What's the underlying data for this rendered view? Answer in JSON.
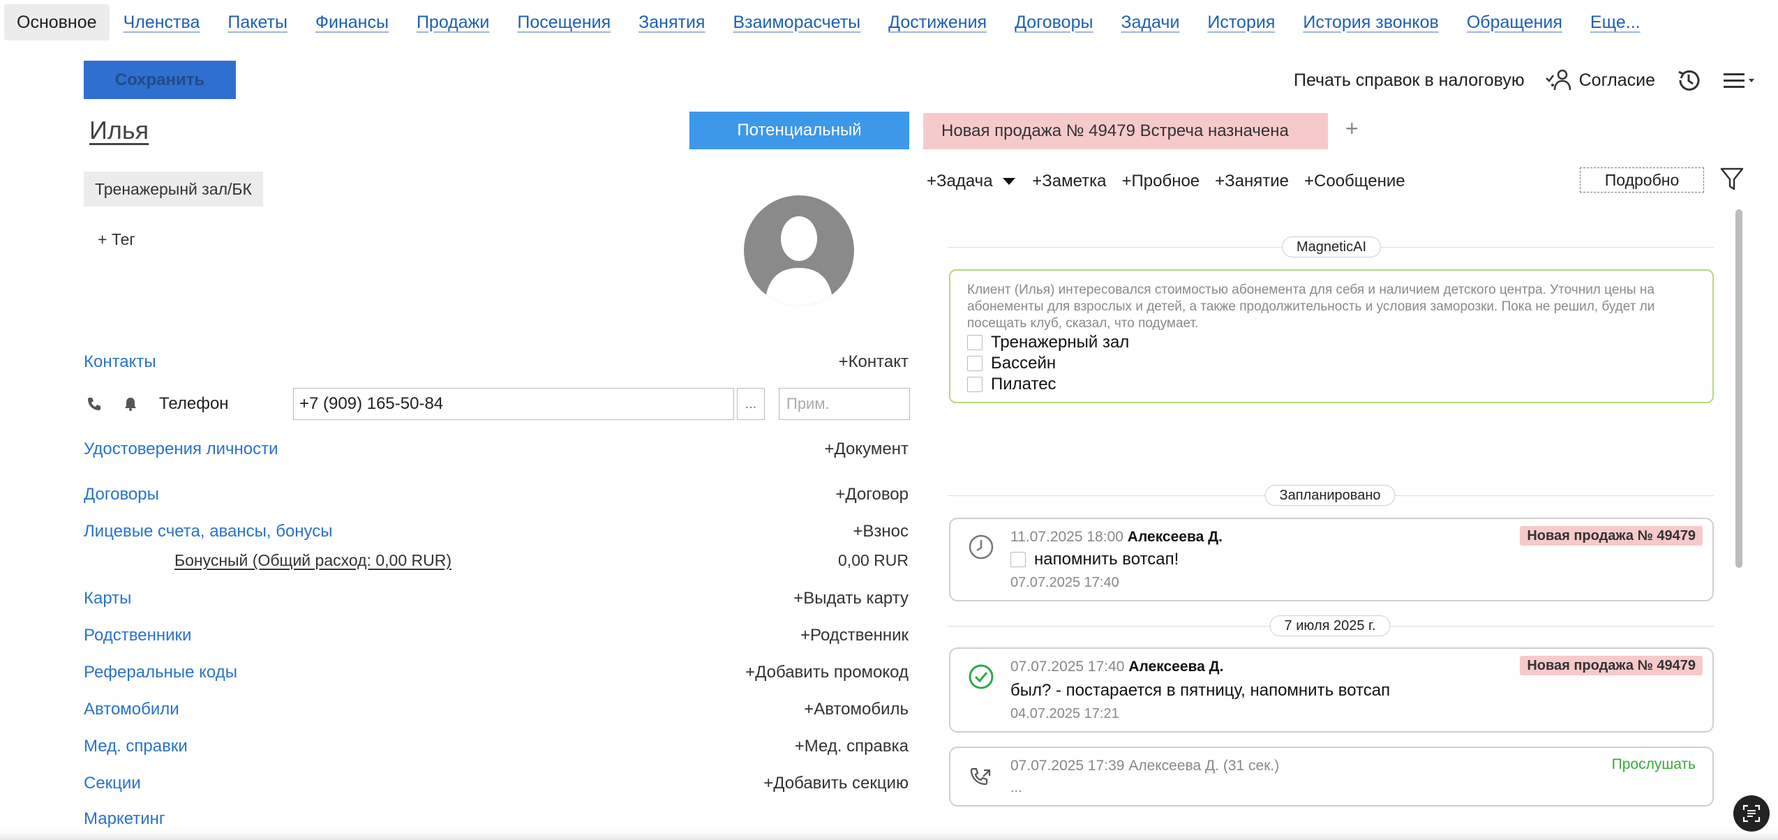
{
  "tabs": [
    "Основное",
    "Членства",
    "Пакеты",
    "Финансы",
    "Продажи",
    "Посещения",
    "Занятия",
    "Взаиморасчеты",
    "Достижения",
    "Договоры",
    "Задачи",
    "История",
    "История звонков",
    "Обращения",
    "Еще..."
  ],
  "toolbar": {
    "save_label": "Сохранить",
    "tax_print_label": "Печать справок в налоговую",
    "consent_label": "Согласие"
  },
  "client": {
    "name": "Илья",
    "status_label": "Потенциальный",
    "sale_tag": "Новая продажа № 49479  Встреча назначена",
    "add_tab": "+",
    "club_tag": "Тренажерынй зал/БК",
    "add_tag": "+ Тег"
  },
  "sections": {
    "contacts": {
      "label": "Контакты",
      "action": "+Контакт"
    },
    "phone": {
      "label": "Телефон",
      "value": "+7 (909) 165-50-84",
      "dots": "...",
      "note_placeholder": "Прим."
    },
    "ids": {
      "label": "Удостоверения личности",
      "action": "+Документ"
    },
    "contracts": {
      "label": "Договоры",
      "action": "+Договор"
    },
    "accounts": {
      "label": "Лицевые счета, авансы, бонусы",
      "action": "+Взнос"
    },
    "bonus": {
      "label": "Бонусный  (Общий расход: 0,00 RUR)",
      "value": "0,00 RUR"
    },
    "cards": {
      "label": "Карты",
      "action": "+Выдать карту"
    },
    "relatives": {
      "label": "Родственники",
      "action": "+Родственник"
    },
    "referral": {
      "label": "Реферальные коды",
      "action": "+Добавить промокод"
    },
    "cars": {
      "label": "Автомобили",
      "action": "+Автомобиль"
    },
    "medical": {
      "label": "Мед. справки",
      "action": "+Мед. справка"
    },
    "sections_item": {
      "label": "Секции",
      "action": "+Добавить секцию"
    },
    "marketing": {
      "label": "Маркетинг"
    }
  },
  "timeline": {
    "actions": [
      "+Задача",
      "+Заметка",
      "+Пробное",
      "+Занятие",
      "+Сообщение"
    ],
    "detail_label": "Подробно",
    "ai": {
      "header": "MagneticAI",
      "text": "Клиент (Илья) интересовался стоимостью абонемента для себя и наличием детского центра. Уточнил цены на абонементы для взрослых и детей, а также продолжительность и условия заморозки. Пока не решил, будет ли посещать клуб, сказал, что подумает.",
      "checks": [
        "Тренажерный зал",
        "Бассейн",
        "Пилатес"
      ]
    },
    "planned_label": "Запланировано",
    "planned_card": {
      "datetime": "11.07.2025 18:00",
      "author": "Алексеева Д.",
      "badge": "Новая продажа № 49479",
      "text": "напомнить вотсап!",
      "created": "07.07.2025 17:40"
    },
    "date_label": "7 июля 2025 г.",
    "done_card": {
      "datetime": "07.07.2025 17:40",
      "author": "Алексеева Д.",
      "badge": "Новая продажа № 49479",
      "text": "был? - постарается в пятницу, напомнить вотсап",
      "created": "04.07.2025 17:21"
    },
    "call_card": {
      "meta": "07.07.2025 17:39 Алексеева Д. (31 сек.)",
      "listen": "Прослушать",
      "text": "..."
    }
  },
  "colors": {
    "link_blue": "#2a72cc",
    "save_blue": "#2f6fd0",
    "status_blue": "#3d98ea",
    "sale_pink": "#f6caca",
    "ai_green": "#b7da7a",
    "listen_green": "#3aa83a"
  }
}
